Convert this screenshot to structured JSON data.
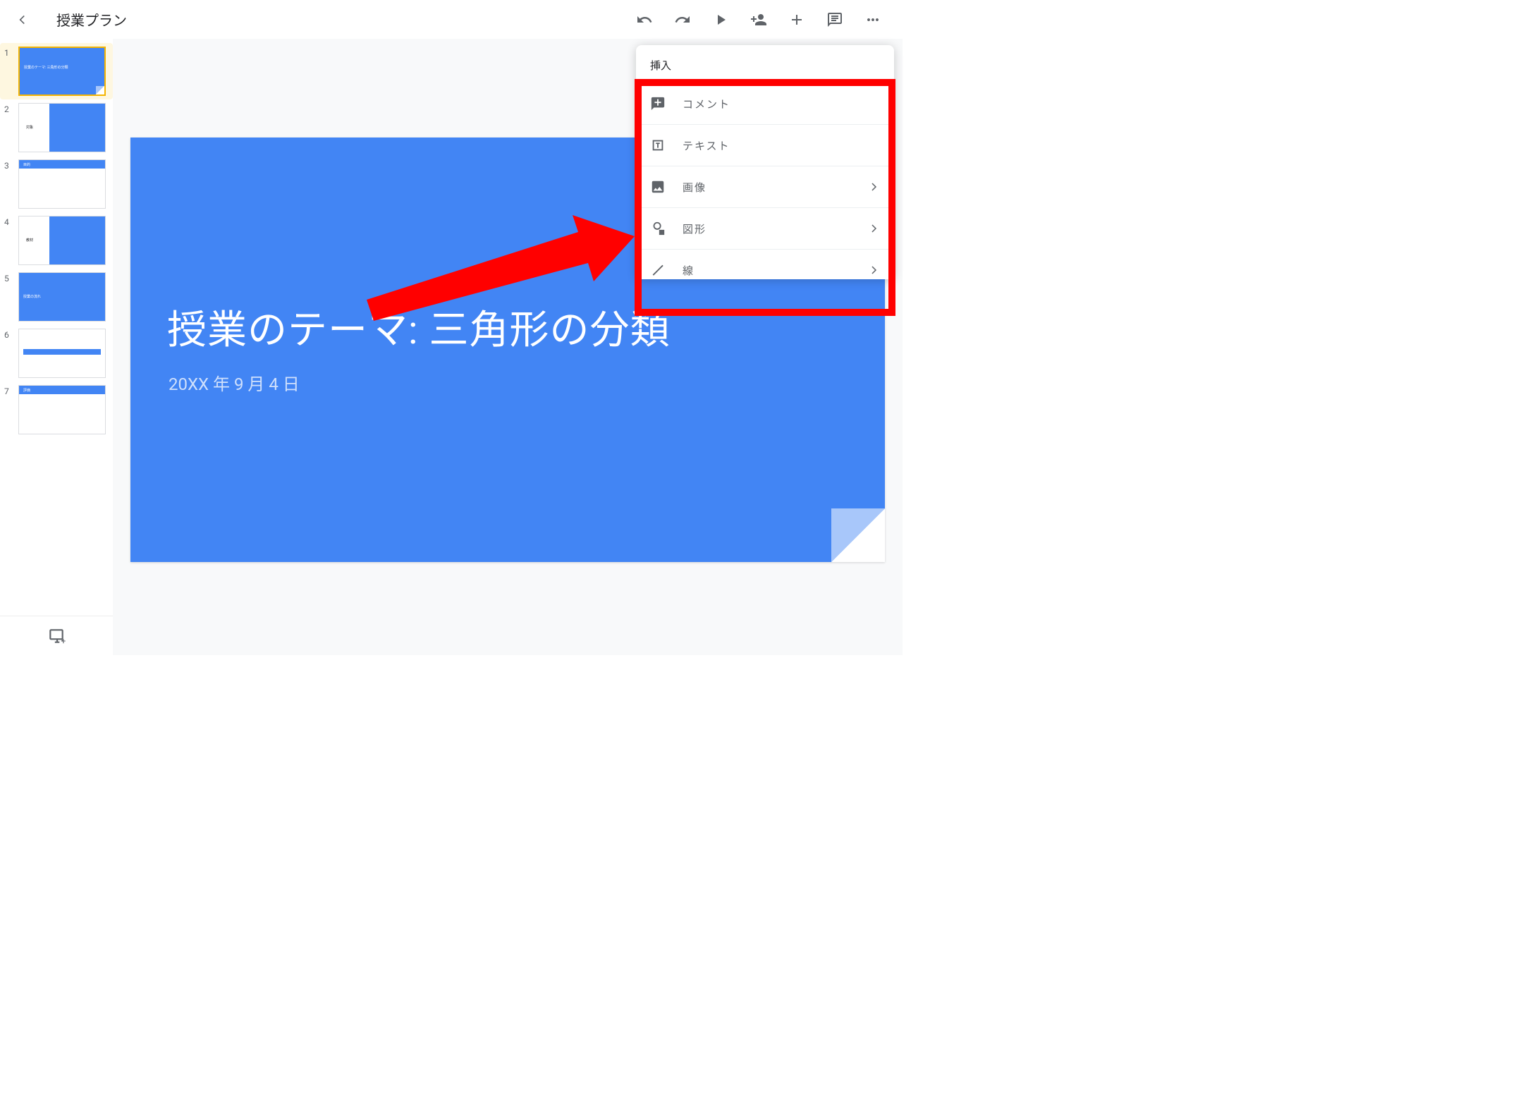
{
  "header": {
    "doc_title": "授業プラン"
  },
  "dropdown": {
    "title": "挿入",
    "items": [
      {
        "label": "コメント",
        "icon": "comment",
        "has_chevron": false
      },
      {
        "label": "テキスト",
        "icon": "text",
        "has_chevron": false
      },
      {
        "label": "画像",
        "icon": "image",
        "has_chevron": true
      },
      {
        "label": "図形",
        "icon": "shape",
        "has_chevron": true
      },
      {
        "label": "線",
        "icon": "line",
        "has_chevron": true
      }
    ]
  },
  "slide": {
    "title": "授業のテーマ: 三角形の分類",
    "date": "20XX 年 9 月 4 日"
  },
  "thumbs": [
    {
      "num": "1",
      "title": "授業のテーマ: 三角形の分類"
    },
    {
      "num": "2",
      "title": "対象"
    },
    {
      "num": "3",
      "title": "目的"
    },
    {
      "num": "4",
      "title": "教材"
    },
    {
      "num": "5",
      "title": "授業の流れ"
    },
    {
      "num": "6",
      "title": ""
    },
    {
      "num": "7",
      "title": "評価"
    }
  ]
}
